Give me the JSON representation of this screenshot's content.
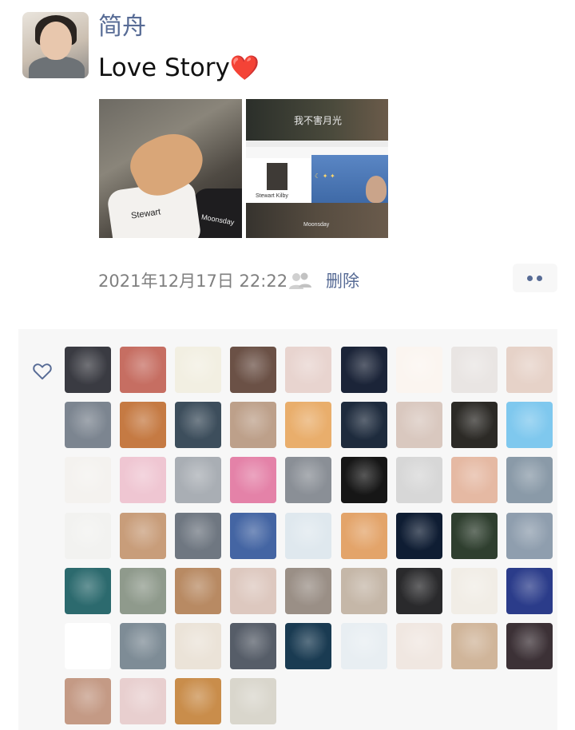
{
  "post": {
    "author_name": "简舟",
    "text": "Love Story",
    "emoji": "❤️",
    "timestamp": "2021年12月17日 22:22",
    "delete_label": "删除"
  },
  "photo1": {
    "caption_left": "Stewart",
    "caption_right": "Moonsday"
  },
  "photo2": {
    "title": "我不害月光",
    "card_text": "Stewart Kilby",
    "bottom_text": "Moonsday"
  },
  "icons": {
    "share": "contacts-icon",
    "more": "more-dots-icon",
    "like": "heart-outline-icon"
  },
  "colors": {
    "link": "#576b95",
    "panel": "#f7f7f7",
    "time": "#7f7f7f"
  },
  "likes": {
    "count": 58,
    "avatar_colors": [
      [
        "#3a3b42",
        "#c66e62",
        "#f2efe2",
        "#6b5146",
        "#e8d4cf",
        "#1b2438",
        "#fbf5f0",
        "#e9e5e3",
        "#e6d2c8"
      ],
      [
        "#7c8590",
        "#c57a43",
        "#3d4e5c",
        "#bda08a",
        "#e9ae6c",
        "#1e2b3d",
        "#d9c8bf",
        "#2c2a26",
        "#7fc8ee"
      ],
      [
        "#f4f2ef",
        "#efc6d2",
        "#a9aeb4",
        "#e482a8",
        "#8a8f96",
        "#161616",
        "#d7d7d7",
        "#e5b9a3",
        "#8a9aa8"
      ],
      [
        "#f2f2f0",
        "#c89d7a",
        "#6f7781",
        "#4465a3",
        "#dfe8ee",
        "#e3a46a",
        "#0f1d33",
        "#2f3f2f",
        "#8f9eae"
      ],
      [
        "#2c6a6e",
        "#8f9a8c",
        "#b88a63",
        "#ddc8bf",
        "#9a8f86",
        "#c5b7a8",
        "#2a2a2c",
        "#f1ede6",
        "#2b3c8a"
      ],
      [
        "#ffffff",
        "#7e8c96",
        "#ebe3d8",
        "#565d68",
        "#1a3b52",
        "#e8eef2",
        "#f0e7e1",
        "#d0b59a",
        "#3c3136"
      ],
      [
        "#c49a85",
        "#e8cfcf",
        "#c98d4b",
        "#d9d6cc"
      ]
    ]
  }
}
